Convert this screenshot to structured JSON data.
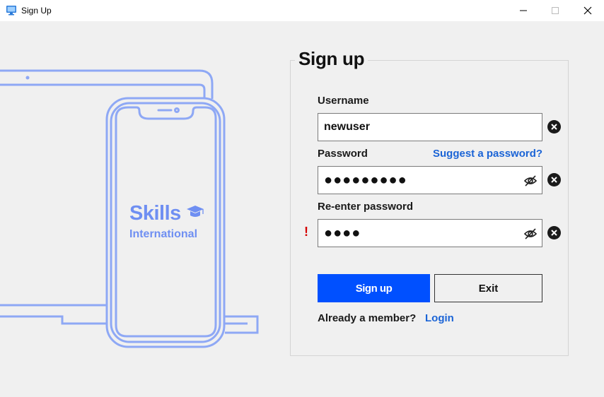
{
  "window": {
    "title": "Sign Up",
    "app_icon": "monitor-icon",
    "controls": [
      "minimize-icon",
      "maximize-icon",
      "close-icon"
    ]
  },
  "illustration": {
    "brand_line1": "Skills",
    "brand_line2": "International",
    "brand_color": "#6f8ff2",
    "icons": [
      "laptop-icon",
      "phone-icon",
      "graduation-cap-icon"
    ]
  },
  "form": {
    "title": "Sign up",
    "username": {
      "label": "Username",
      "value": "newuser"
    },
    "password": {
      "label": "Password",
      "masked_value": "●●●●●●●●●",
      "suggest_link": "Suggest a password?"
    },
    "reenter": {
      "label": "Re-enter password",
      "masked_value": "●●●●",
      "warning": "!"
    },
    "signup_button": "Sign up",
    "exit_button": "Exit",
    "member_text": "Already a member?",
    "login_link": "Login"
  },
  "colors": {
    "accent": "#0050ff",
    "link": "#1b64d6",
    "warning": "#d40000"
  }
}
